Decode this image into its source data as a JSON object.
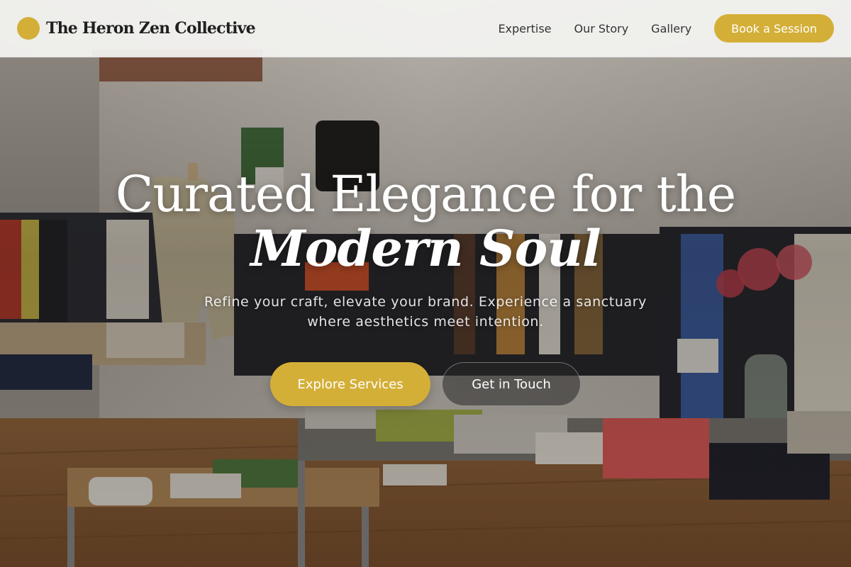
{
  "colors": {
    "accent": "#d4af37",
    "nav_background": "#f4f4f2",
    "hero_text": "#ffffff"
  },
  "brand": {
    "logo_icon": "gold-circle-icon",
    "name": "The Heron Zen Collective"
  },
  "nav": {
    "links": [
      "Expertise",
      "Our Story",
      "Gallery"
    ],
    "cta_label": "Book a Session"
  },
  "hero": {
    "background_image": "clothing-boutique-interior-photo",
    "title_line1": "Curated Elegance for the",
    "title_line2": "Modern Soul",
    "subtitle": "Refine your craft, elevate your brand. Experience a sanctuary where aesthetics meet intention.",
    "primary_button": "Explore Services",
    "secondary_button": "Get in Touch"
  }
}
